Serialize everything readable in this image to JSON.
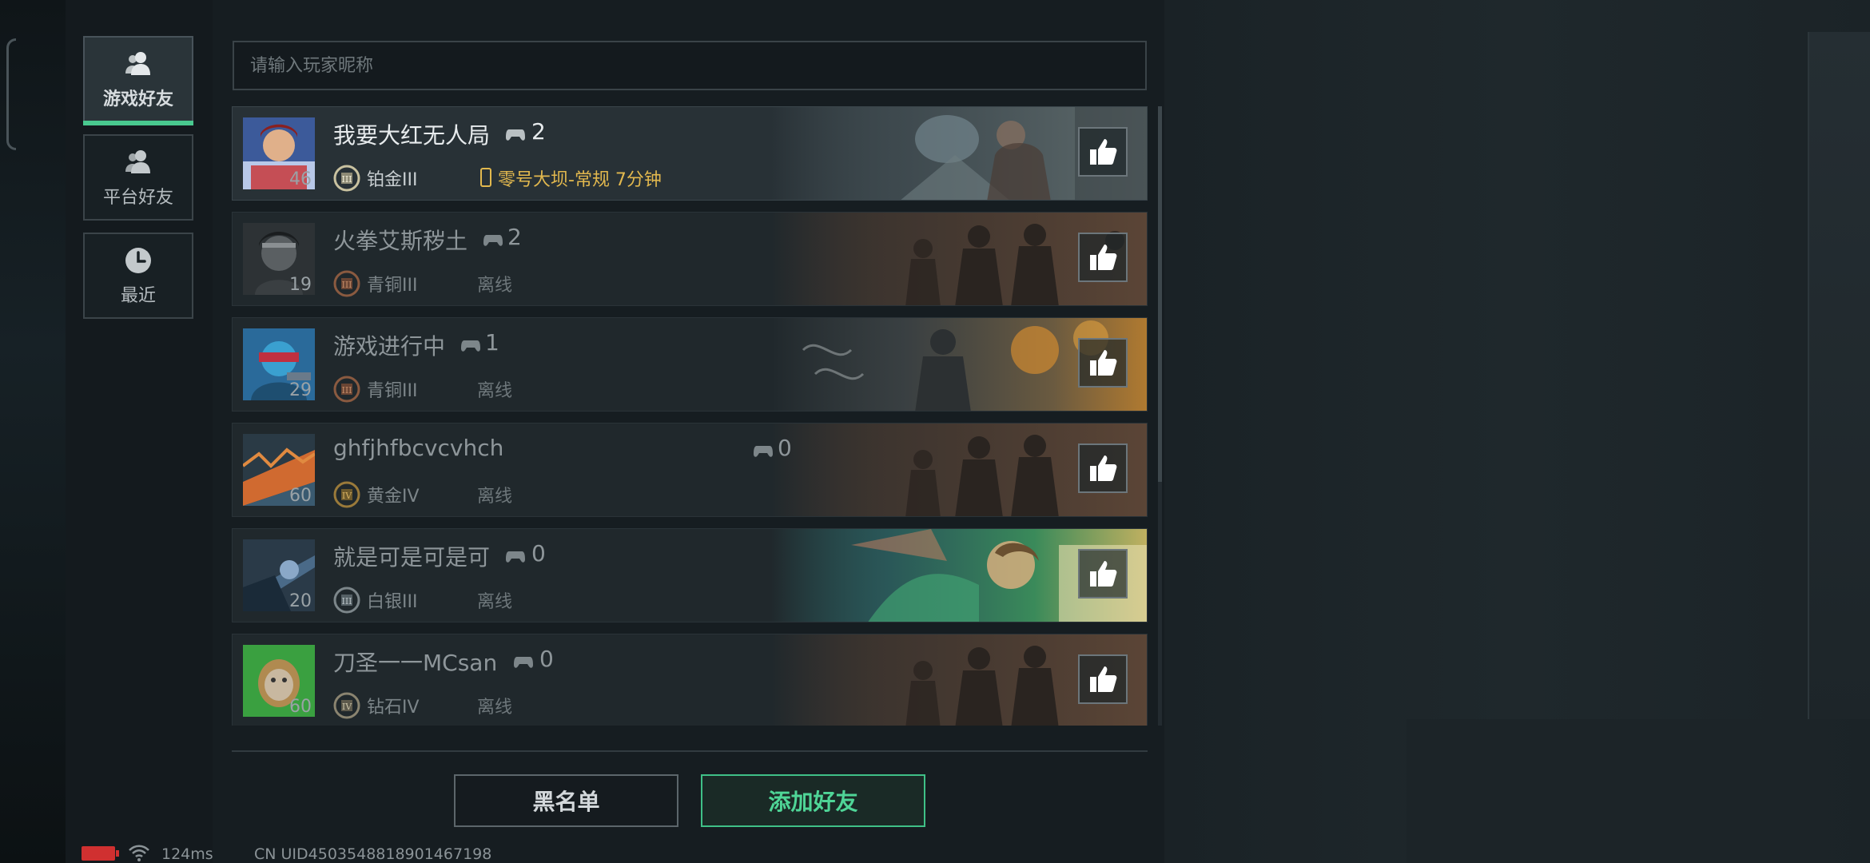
{
  "sidebar": {
    "tabs": [
      {
        "label": "游戏好友",
        "icon": "friends-icon",
        "active": true
      },
      {
        "label": "平台好友",
        "icon": "friends-icon",
        "active": false
      },
      {
        "label": "最近",
        "icon": "clock-icon",
        "active": false
      }
    ]
  },
  "search": {
    "placeholder": "请输入玩家昵称"
  },
  "friends": [
    {
      "name": "我要大红无人局",
      "games": "2",
      "level": "46",
      "rank": "铂金III",
      "status": "零号大坝-常规 7分钟",
      "online": true
    },
    {
      "name": "火拳艾斯秽土",
      "games": "2",
      "level": "19",
      "rank": "青铜III",
      "status": "离线",
      "online": false
    },
    {
      "name": "游戏进行中",
      "games": "1",
      "level": "29",
      "rank": "青铜III",
      "status": "离线",
      "online": false
    },
    {
      "name": "ghfjhfbcvcvhch",
      "games": "0",
      "level": "60",
      "rank": "黄金IV",
      "status": "离线",
      "online": false
    },
    {
      "name": "就是可是可是可",
      "games": "0",
      "level": "20",
      "rank": "白银III",
      "status": "离线",
      "online": false
    },
    {
      "name": "刀圣一一MCsan",
      "games": "0",
      "level": "60",
      "rank": "钻石IV",
      "status": "离线",
      "online": false
    }
  ],
  "buttons": {
    "blacklist": "黑名单",
    "add_friend": "添加好友"
  },
  "statusbar": {
    "ping": "124ms",
    "uid": "CN UID4503548818901467198"
  },
  "colors": {
    "accent": "#49c98f",
    "online_status": "#e2b84e",
    "battery": "#d03030"
  }
}
